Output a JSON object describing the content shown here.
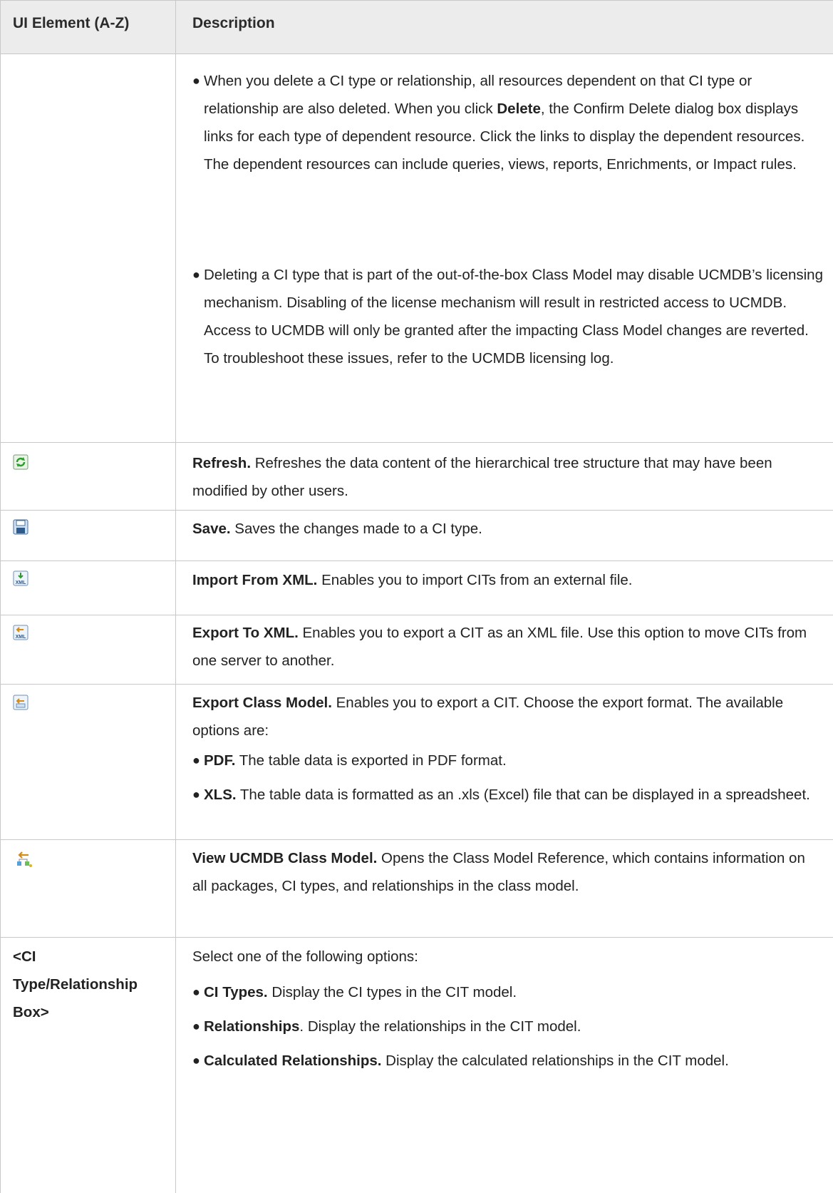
{
  "table": {
    "headers": [
      "UI Element (A-Z)",
      "Description"
    ],
    "rows": [
      {
        "element": "",
        "bullets": [
          {
            "pre": "When you delete a CI type or relationship, all resources dependent on that CI type or relationship are also deleted. When you click ",
            "bold": "Delete",
            "post": ", the Confirm Delete dialog box displays links for each type of dependent resource. Click the links to display the dependent resources. The dependent resources can include queries, views, reports, Enrichments, or Impact rules."
          },
          {
            "pre": "Deleting a CI type that is part of the out-of-the-box Class Model may disable UCMDB’s licensing mechanism. Disabling of the license mechanism will result in restricted access to UCMDB. Access to UCMDB will only be granted after the impacting Class Model changes are reverted. To troubleshoot these issues, refer to the UCMDB licensing log.",
            "bold": "",
            "post": ""
          }
        ]
      },
      {
        "icon": "refresh-icon",
        "bold": "Refresh.",
        "text": " Refreshes the data content of the hierarchical tree structure that may have been modified by other users."
      },
      {
        "icon": "save-icon",
        "bold": "Save.",
        "text": " Saves the changes made to a CI type."
      },
      {
        "icon": "import-xml-icon",
        "bold": "Import From XML.",
        "text": " Enables you to import CITs from an external file."
      },
      {
        "icon": "export-xml-icon",
        "bold": "Export To XML.",
        "text": " Enables you to export a CIT as an XML file. Use this option to move CITs from one server to another."
      },
      {
        "icon": "export-class-model-icon",
        "bold": "Export Class Model.",
        "text": " Enables you to export a CIT. Choose the export format. The available options are:",
        "bullets": [
          {
            "bold": "PDF.",
            "post": " The table data is exported in PDF format."
          },
          {
            "bold": "XLS.",
            "post": " The table data is formatted as an .xls (Excel) file that can be displayed in a spreadsheet."
          }
        ]
      },
      {
        "icon": "view-class-model-icon",
        "bold": "View UCMDB Class Model.",
        "text": " Opens the Class Model Reference, which contains information on all packages, CI types, and relationships in the class model."
      },
      {
        "element": "<CI Type/Relationship Box>",
        "element_lines": [
          "<CI",
          "Type/Relationship",
          "Box>"
        ],
        "text": "Select one of the following options:",
        "bullets": [
          {
            "bold": "CI Types.",
            "post": " Display the CI types in the CIT model."
          },
          {
            "bold": "Relationships",
            "post": ". Display the relationships in the CIT model."
          },
          {
            "bold": "Calculated Relationships.",
            "post": " Display the calculated relationships in the CIT model."
          }
        ]
      }
    ]
  },
  "colors": {
    "header_bg": "#ececec",
    "border": "#c8c8c8",
    "text": "#222222"
  }
}
